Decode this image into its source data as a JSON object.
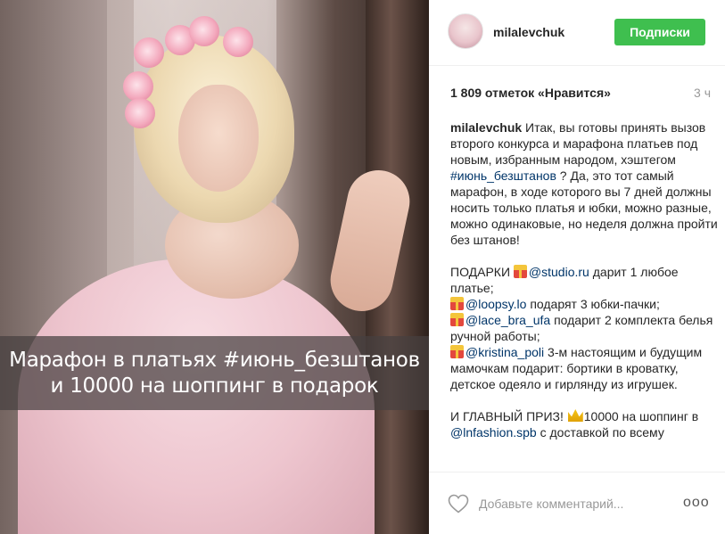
{
  "photo": {
    "overlay_line1": "Марафон в платьях #июнь_безштанов",
    "overlay_line2": "и 10000 на шоппинг в подарок"
  },
  "header": {
    "username": "milalevchuk",
    "follow_label": "Подписки",
    "follow_color": "#3fbf4f"
  },
  "stats": {
    "likes": "1 809 отметок «Нравится»",
    "time": "3 ч"
  },
  "post": {
    "author": "milalevchuk",
    "text_1": "Итак, вы готовы принять вызов второго конкурса и марафона платьев под новым, избранным народом, хэштегом",
    "hashtag": "#июнь_безштанов",
    "text_2": "? Да, это тот самый марафон, в ходе которого вы 7 дней должны носить только платья и юбки, можно разные, можно одинаковые, но неделя должна пройти без штанов!",
    "gifts_heading": "ПОДАРКИ",
    "gift_1_mention": "@studio.ru",
    "gift_1_text": "дарит 1 любое платье;",
    "gift_2_mention": "@loopsy.lo",
    "gift_2_text": "подарят 3 юбки-пачки;",
    "gift_3_mention": "@lace_bra_ufa",
    "gift_3_text": "подарит 2 комплекта белья ручной работы;",
    "gift_4_mention": "@kristina_poli",
    "gift_4_text": "3-м настоящим и будущим мамочкам подарит: бортики в кроватку, детское одеяло и гирлянду из игрушек.",
    "grand_prize_text": "И ГЛАВНЫЙ ПРИЗ!",
    "grand_prize_amount": "10000 на шоппинг",
    "grand_prize_in": "в",
    "grand_prize_mention": "@lnfashion.spb",
    "grand_prize_tail": "с доставкой по всему"
  },
  "footer": {
    "comment_placeholder": "Добавьте комментарий...",
    "more_label": "ooo"
  },
  "icons": {
    "heart": "heart-outline-icon",
    "gift": "gift-emoji-icon",
    "crown": "crown-emoji-icon"
  }
}
